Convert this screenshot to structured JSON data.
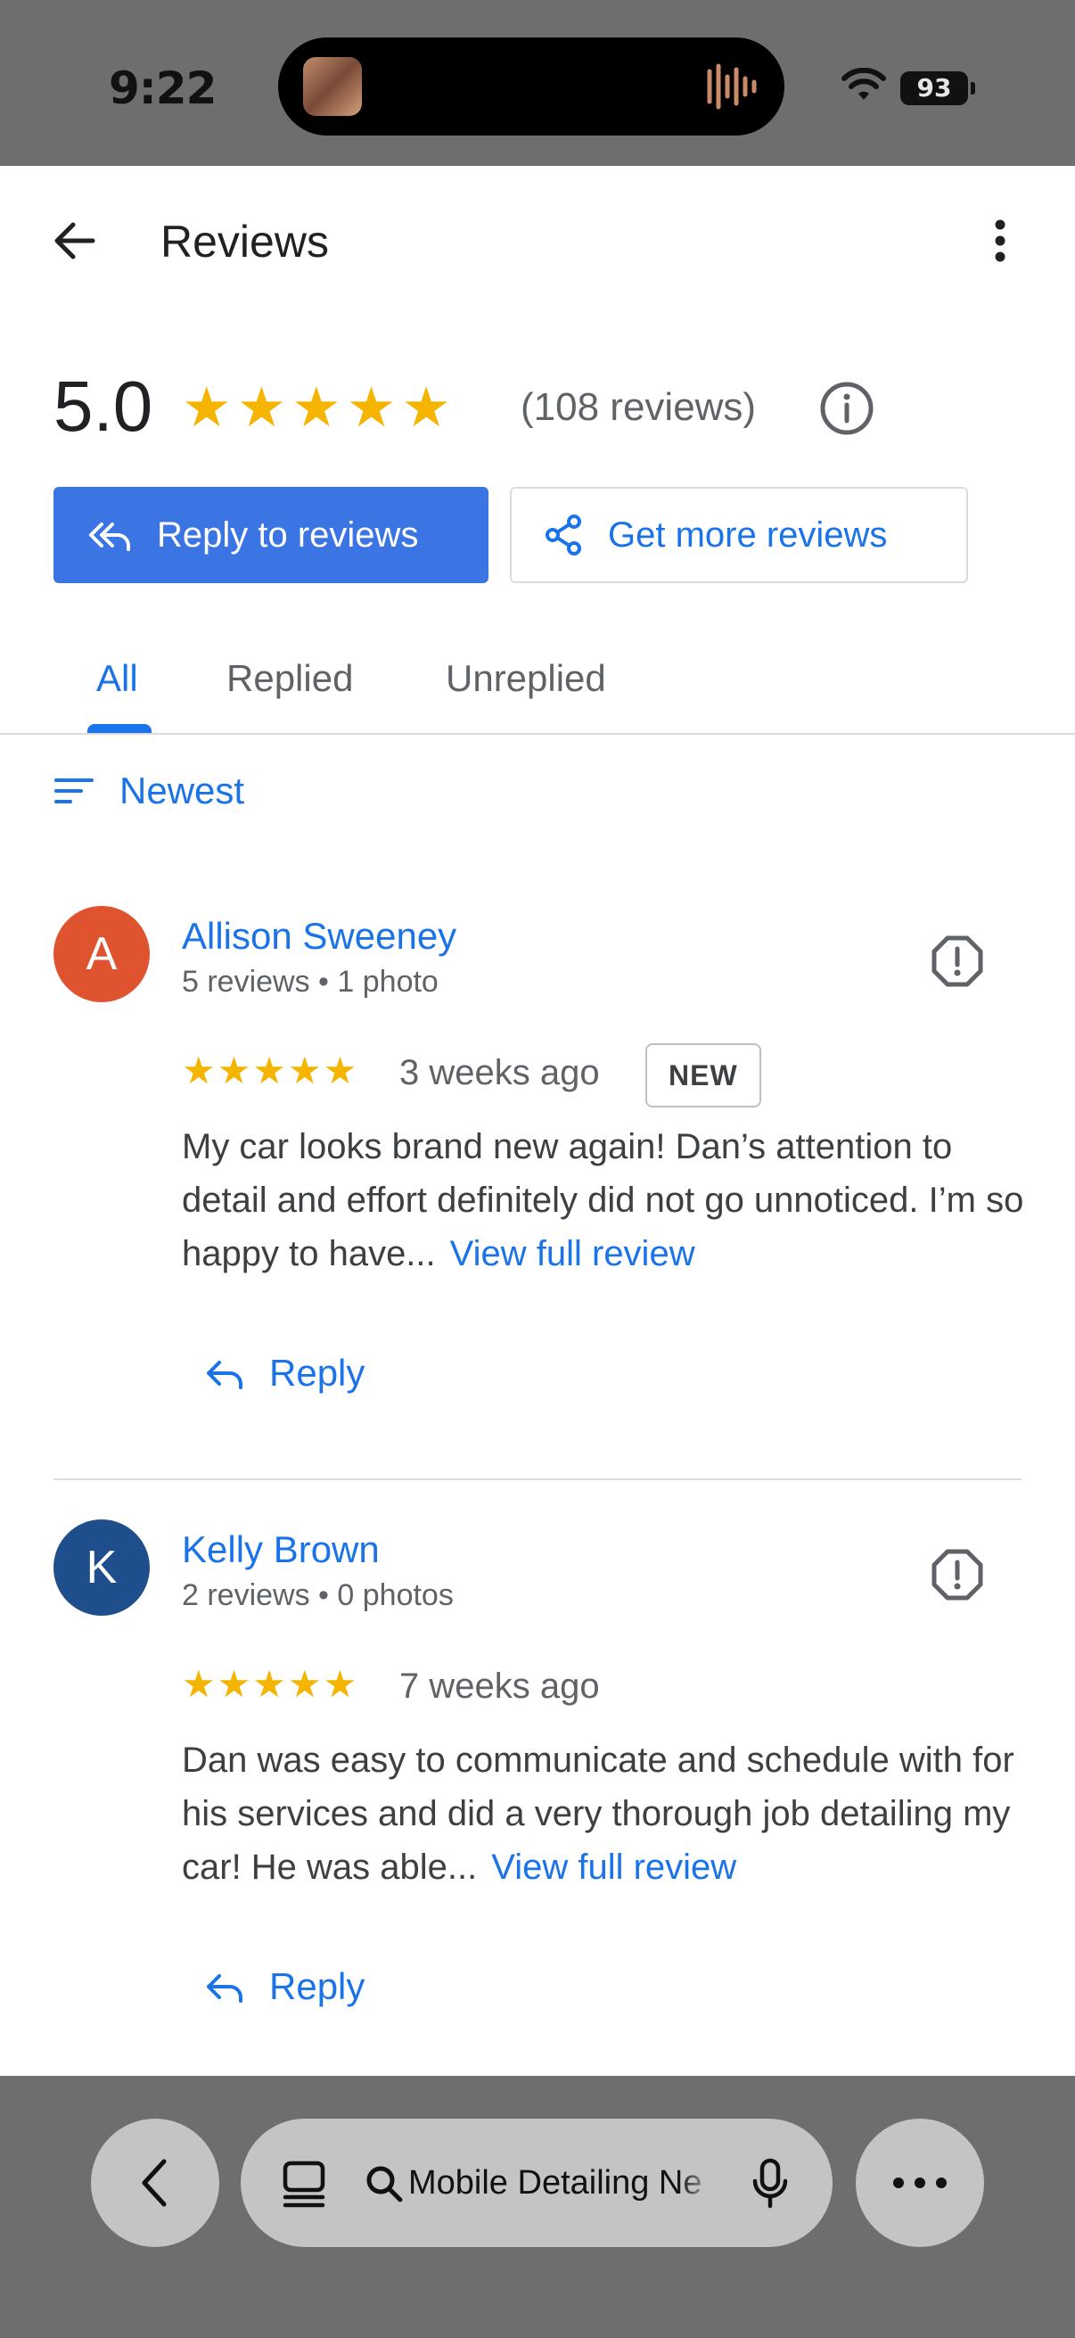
{
  "status_bar": {
    "time": "9:22",
    "battery": "93"
  },
  "appbar": {
    "title": "Reviews"
  },
  "summary": {
    "rating": "5.0",
    "stars": "★★★★★",
    "count_label": "(108 reviews)"
  },
  "actions": {
    "reply_label": "Reply to reviews",
    "more_label": "Get more reviews"
  },
  "tabs": [
    {
      "label": "All",
      "active": true
    },
    {
      "label": "Replied",
      "active": false
    },
    {
      "label": "Unreplied",
      "active": false
    }
  ],
  "sort": {
    "label": "Newest"
  },
  "reviews": [
    {
      "initial": "A",
      "avatar_color": "#e0532f",
      "name": "Allison Sweeney",
      "meta": "5 reviews • 1 photo",
      "stars": "★★★★★",
      "rating": 5,
      "date": "3 weeks ago",
      "badge": "NEW",
      "text": "My car looks brand new again! Dan’s attention to detail and effort definitely did not go unnoticed. I’m so happy to have...",
      "view_full": "View full review",
      "reply_label": "Reply"
    },
    {
      "initial": "K",
      "avatar_color": "#1f4e8c",
      "name": "Kelly Brown",
      "meta": "2 reviews • 0 photos",
      "stars": "★★★★★",
      "rating": 5,
      "date": "7 weeks ago",
      "text": "Dan was easy to communicate and schedule with for his services and did a very thorough job detailing my car! He was able...",
      "view_full": "View full review",
      "reply_label": "Reply"
    }
  ],
  "browser_bar": {
    "url_text": "Mobile Detailing Ne"
  },
  "colors": {
    "accent": "#1a73e8",
    "star": "#f4b400",
    "primary_button": "#3b74e3"
  }
}
